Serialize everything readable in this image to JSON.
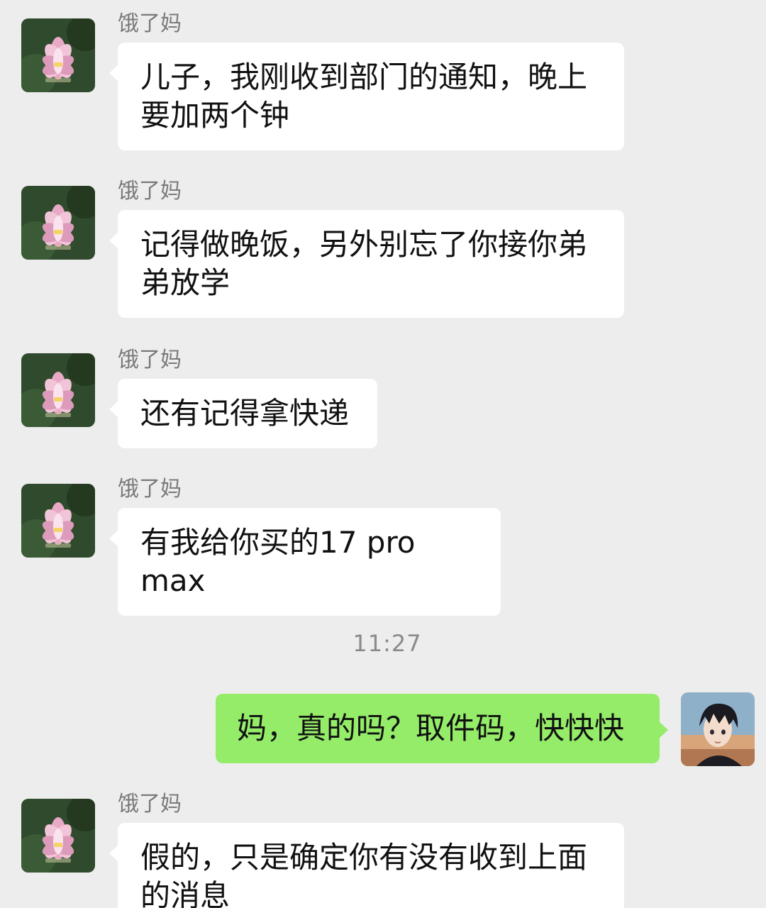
{
  "colors": {
    "background": "#ededed",
    "incoming_bubble": "#ffffff",
    "outgoing_bubble": "#95ec69",
    "sender_name": "#7a7a7a"
  },
  "chat": {
    "timestamp": "11:27",
    "messages": [
      {
        "from": "other",
        "sender": "饿了妈",
        "avatar_icon": "lotus-avatar-icon",
        "text": "儿子，我刚收到部门的通知，晚上要加两个钟"
      },
      {
        "from": "other",
        "sender": "饿了妈",
        "avatar_icon": "lotus-avatar-icon",
        "text": "记得做晚饭，另外别忘了你接你弟弟放学"
      },
      {
        "from": "other",
        "sender": "饿了妈",
        "avatar_icon": "lotus-avatar-icon",
        "text": "还有记得拿快递"
      },
      {
        "from": "other",
        "sender": "饿了妈",
        "avatar_icon": "lotus-avatar-icon",
        "text": "有我给你买的17 pro max"
      },
      {
        "from": "me",
        "avatar_icon": "anime-boy-avatar-icon",
        "text": "妈，真的吗？取件码，快快快"
      },
      {
        "from": "other",
        "sender": "饿了妈",
        "avatar_icon": "lotus-avatar-icon",
        "text": "假的，只是确定你有没有收到上面的消息"
      }
    ]
  }
}
